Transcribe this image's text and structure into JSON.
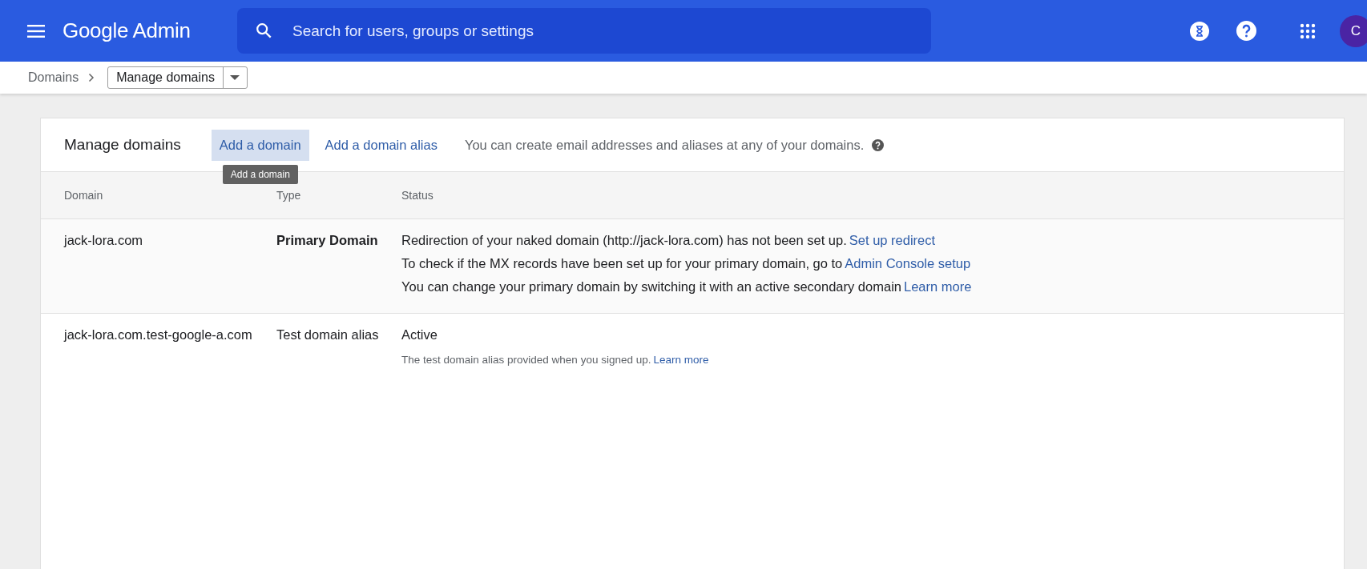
{
  "header": {
    "logo": "Google Admin",
    "search": {
      "placeholder": "Search for users, groups or settings"
    },
    "avatar": "C"
  },
  "breadcrumb": {
    "parent": "Domains",
    "current": "Manage domains"
  },
  "card": {
    "title": "Manage domains",
    "actions": [
      {
        "label": "Add a domain",
        "selected": true
      },
      {
        "label": "Add a domain alias",
        "selected": false
      }
    ],
    "description": "You can create email addresses and aliases at any of your domains.",
    "tooltip": "Add a domain"
  },
  "table": {
    "columns": [
      "Domain",
      "Type",
      "Status"
    ],
    "rows": [
      {
        "domain": "jack-lora.com",
        "type": "Primary Domain",
        "primary": true,
        "status": [
          {
            "kind": "line",
            "text": "Redirection of your naked domain (http://jack-lora.com) has not been set up.",
            "link": "Set up redirect"
          },
          {
            "kind": "line",
            "text": "To check if the MX records have been set up for your primary domain, go to",
            "link": "Admin Console setup"
          },
          {
            "kind": "line",
            "text": "You can change your primary domain by switching it with an active secondary domain",
            "link": "Learn more"
          }
        ]
      },
      {
        "domain": "jack-lora.com.test-google-a.com",
        "type": "Test domain alias",
        "primary": false,
        "status": [
          {
            "kind": "line",
            "text": "Active"
          },
          {
            "kind": "note",
            "text": "The test domain alias provided when you signed up.",
            "link": "Learn more"
          }
        ]
      }
    ]
  }
}
